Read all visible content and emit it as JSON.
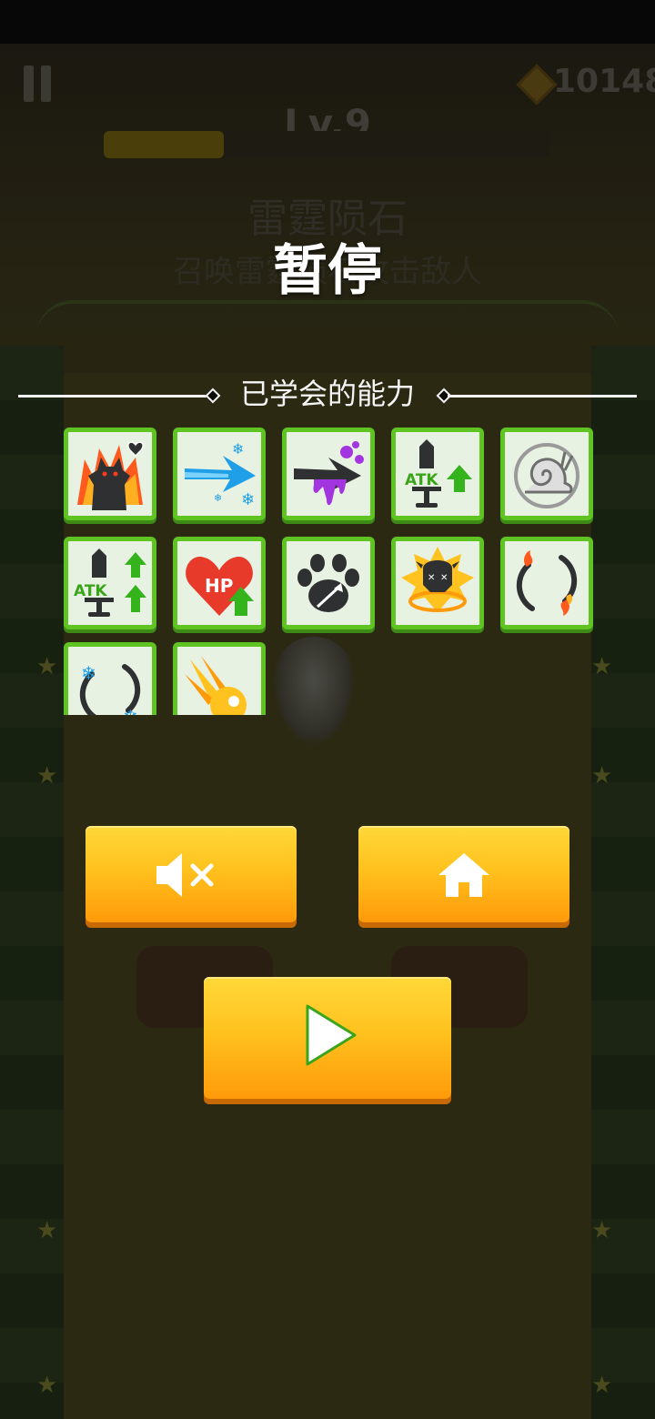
{
  "hud": {
    "gem_count": "10148",
    "level": "Lv.9",
    "xp_progress": 0.27,
    "icons": [
      "pause-icon",
      "gem-icon"
    ]
  },
  "background_skill_card": {
    "title": "雷霆陨石",
    "description": "召唤雷霆陨石攻击敌人"
  },
  "pause_menu": {
    "title": "暂停",
    "learned_label": "已学会的能力",
    "skills": [
      {
        "name": "rage-beast",
        "icon": "beast-rage-icon"
      },
      {
        "name": "frost-arrow",
        "icon": "ice-arrow-icon"
      },
      {
        "name": "poison-arrow",
        "icon": "poison-arrow-icon"
      },
      {
        "name": "atk-up",
        "icon": "attack-up-icon",
        "label": "ATK"
      },
      {
        "name": "slow-snail",
        "icon": "snail-icon"
      },
      {
        "name": "atk-up-double",
        "icon": "attack-up-double-icon",
        "label": "ATK"
      },
      {
        "name": "hp-up",
        "icon": "hp-up-icon",
        "label": "HP"
      },
      {
        "name": "paw-pierce",
        "icon": "paw-arrow-icon"
      },
      {
        "name": "skull-aura",
        "icon": "skull-aura-icon"
      },
      {
        "name": "fire-orbit",
        "icon": "fire-orbit-icon"
      },
      {
        "name": "ice-orbit",
        "icon": "ice-orbit-icon"
      },
      {
        "name": "meteor",
        "icon": "meteor-icon"
      }
    ],
    "buttons": {
      "mute": "mute-icon",
      "home": "home-icon",
      "resume": "play-icon"
    }
  },
  "colors": {
    "button_yellow": "#ffc21e",
    "button_orange": "#ff9a0a",
    "skill_border": "#5fc422"
  }
}
